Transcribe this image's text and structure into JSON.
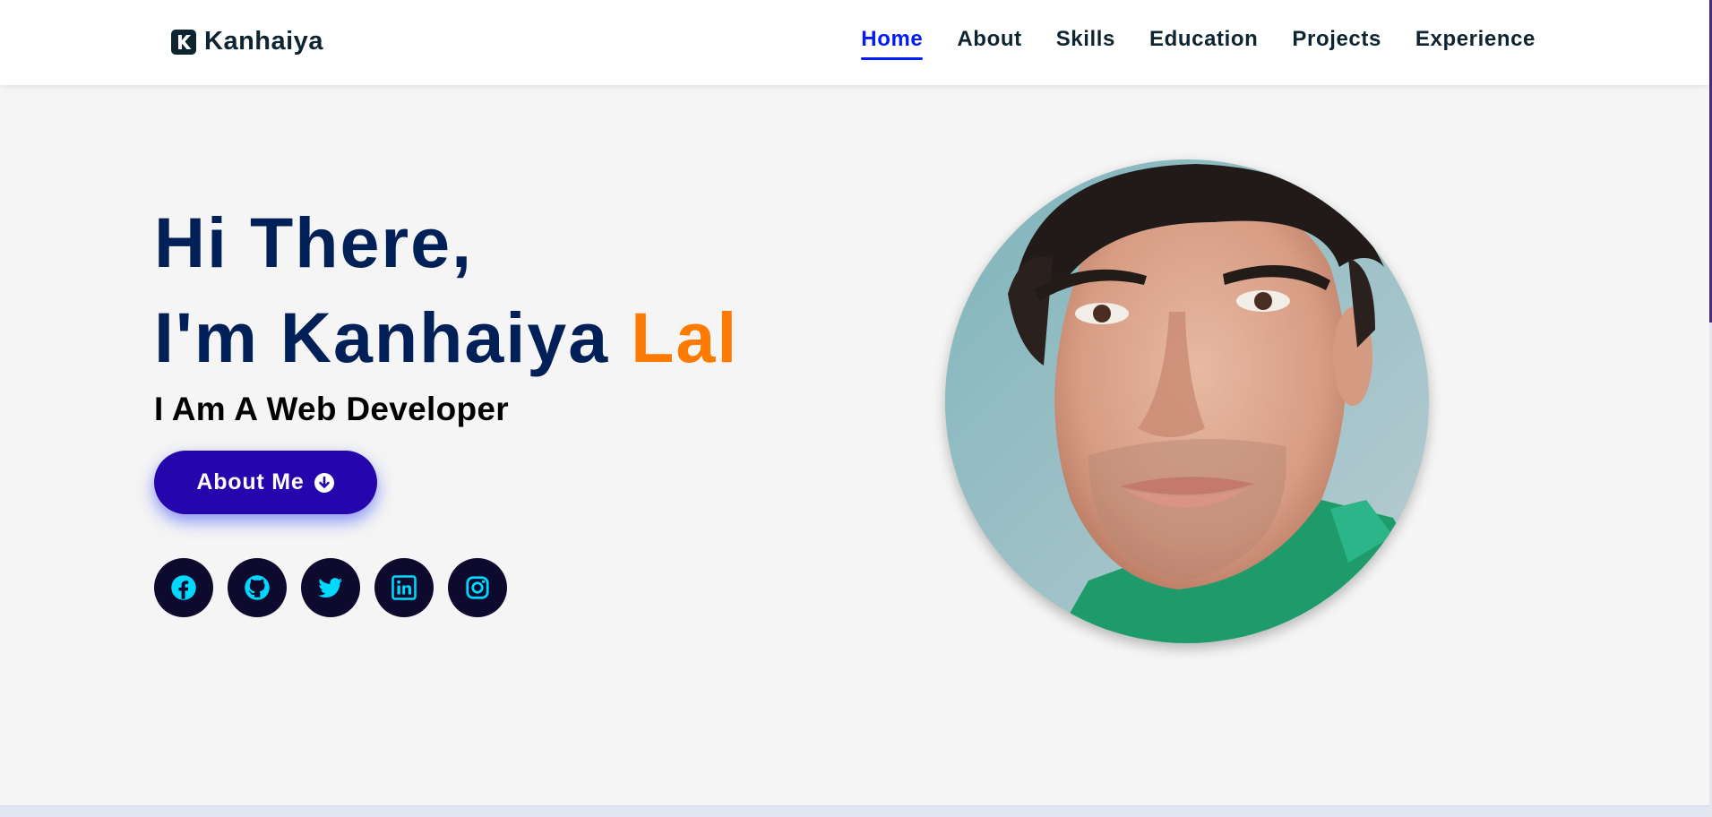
{
  "brand": {
    "name": "Kanhaiya",
    "logo_icon": "k-logo-icon"
  },
  "nav": {
    "items": [
      {
        "label": "Home",
        "active": true
      },
      {
        "label": "About",
        "active": false
      },
      {
        "label": "Skills",
        "active": false
      },
      {
        "label": "Education",
        "active": false
      },
      {
        "label": "Projects",
        "active": false
      },
      {
        "label": "Experience",
        "active": false
      }
    ]
  },
  "hero": {
    "greeting": "Hi There,",
    "intro_prefix": "I'm Kanhaiya",
    "intro_accent": "Lal",
    "role": "I Am A Web Developer",
    "cta_label": "About Me",
    "cta_icon": "arrow-down-circle-icon"
  },
  "socials": [
    {
      "name": "facebook-icon"
    },
    {
      "name": "github-icon"
    },
    {
      "name": "twitter-icon"
    },
    {
      "name": "linkedin-icon"
    },
    {
      "name": "instagram-icon"
    }
  ],
  "colors": {
    "heading": "#002057",
    "accent": "#ff7a00",
    "nav_active": "#011aff",
    "button": "#2506ad",
    "social_bg": "#0e0a2e",
    "social_icon": "#00d9ff"
  }
}
